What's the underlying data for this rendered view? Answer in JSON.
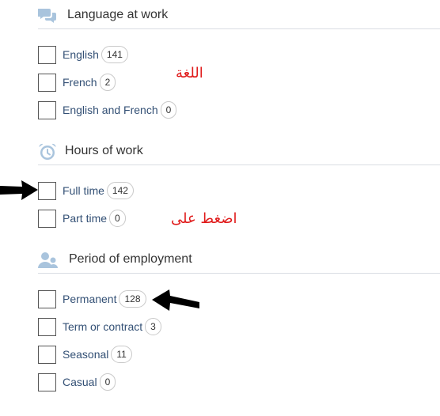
{
  "sections": [
    {
      "title": "Language at work",
      "icon": "chat-bubbles-icon",
      "options": [
        {
          "label": "English",
          "count": "141"
        },
        {
          "label": "French",
          "count": "2"
        },
        {
          "label": "English and French",
          "count": "0"
        }
      ]
    },
    {
      "title": "Hours of work",
      "icon": "alarm-clock-icon",
      "options": [
        {
          "label": "Full time",
          "count": "142"
        },
        {
          "label": "Part time",
          "count": "0"
        }
      ]
    },
    {
      "title": "Period of employment",
      "icon": "users-icon",
      "options": [
        {
          "label": "Permanent",
          "count": "128"
        },
        {
          "label": "Term or contract",
          "count": "3"
        },
        {
          "label": "Seasonal",
          "count": "11"
        },
        {
          "label": "Casual",
          "count": "0"
        }
      ]
    }
  ],
  "annotations": {
    "language": "اللغة",
    "click_on": "اضغط على"
  },
  "colors": {
    "icon": "#a9c4dd",
    "label": "#335075",
    "annotation": "#e01b1b"
  }
}
